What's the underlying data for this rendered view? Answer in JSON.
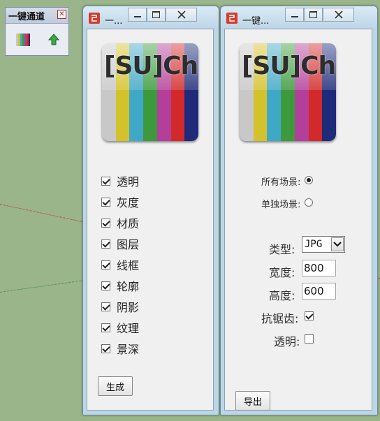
{
  "toolbar": {
    "title": "一键通道",
    "close_glyph": "✕",
    "buttons": [
      {
        "icon": "color-bars-icon"
      },
      {
        "icon": "green-up-arrow-icon"
      }
    ]
  },
  "window1": {
    "title": "一...",
    "logo_text": "[SU]Ch",
    "checkboxes": [
      {
        "label": "透明",
        "checked": true
      },
      {
        "label": "灰度",
        "checked": true
      },
      {
        "label": "材质",
        "checked": true
      },
      {
        "label": "图层",
        "checked": true
      },
      {
        "label": "线框",
        "checked": true
      },
      {
        "label": "轮廓",
        "checked": true
      },
      {
        "label": "阴影",
        "checked": true
      },
      {
        "label": "纹理",
        "checked": true
      },
      {
        "label": "景深",
        "checked": true
      }
    ],
    "generate_label": "生成"
  },
  "window2": {
    "title": "一键...",
    "logo_text": "[SU]Ch",
    "radio_all": {
      "label": "所有场景:",
      "selected": true
    },
    "radio_single": {
      "label": "单独场景:",
      "selected": false
    },
    "type_label": "类型:",
    "type_value": "JPG",
    "width_label": "宽度:",
    "width_value": "800",
    "height_label": "高度:",
    "height_value": "600",
    "antialias_label": "抗锯齿:",
    "antialias_checked": true,
    "transparent_label": "透明:",
    "transparent_checked": false,
    "export_label": "导出"
  },
  "colors": {
    "logo_stripes": [
      "#c8c8c8",
      "#d4c22a",
      "#3fa8c6",
      "#3c9a3c",
      "#b43f9a",
      "#d22a2a",
      "#1f2a7a"
    ]
  }
}
